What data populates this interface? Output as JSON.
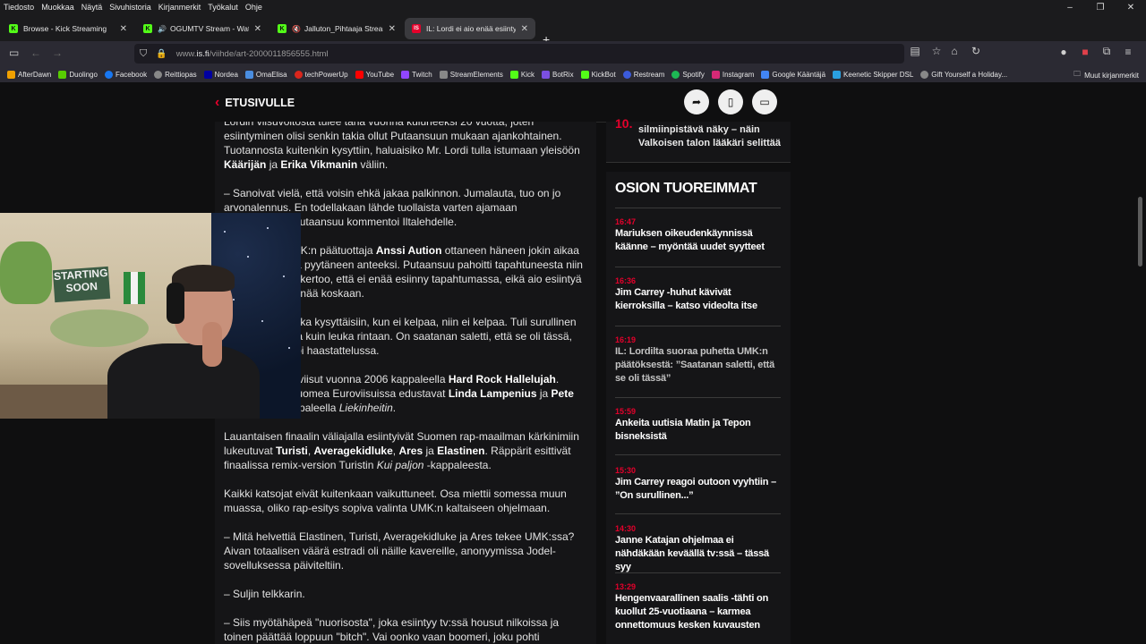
{
  "menu": [
    "Tiedosto",
    "Muokkaa",
    "Näytä",
    "Sivuhistoria",
    "Kirjanmerkit",
    "Työkalut",
    "Ohje"
  ],
  "window_controls": {
    "minimize": "–",
    "restore": "❐",
    "close": "✕"
  },
  "tabs": [
    {
      "title": "Browse - Kick Streaming",
      "favicon": "K",
      "favicon_color": "#53fc18",
      "audio": false,
      "active": false
    },
    {
      "title": "OGUMTV Stream - Watch L",
      "favicon": "K",
      "favicon_color": "#53fc18",
      "audio": true,
      "active": false
    },
    {
      "title": "Jalluton_Pihtaaja Stream - W",
      "favicon": "K",
      "favicon_color": "#53fc18",
      "audio": true,
      "active": false
    },
    {
      "title": "IL: Lordi ei aio enää esiintyä UM",
      "favicon": "IS",
      "favicon_color": "#e4002b",
      "audio": false,
      "active": true
    }
  ],
  "new_tab": "+",
  "url": {
    "prefix": "www.",
    "domain": "is.fi",
    "path": "/viihde/art-2000011856555.html"
  },
  "bookmarks": [
    {
      "label": "AfterDawn",
      "color": "#f0a000"
    },
    {
      "label": "Duolingo",
      "color": "#58cc02"
    },
    {
      "label": "Facebook",
      "color": "#1877f2"
    },
    {
      "label": "Reittiopas",
      "color": "#888888"
    },
    {
      "label": "Nordea",
      "color": "#0000a0"
    },
    {
      "label": "OmaElisa",
      "color": "#4a8de0"
    },
    {
      "label": "techPowerUp",
      "color": "#d9261c"
    },
    {
      "label": "YouTube",
      "color": "#ff0000"
    },
    {
      "label": "Twitch",
      "color": "#9146ff"
    },
    {
      "label": "StreamElements",
      "color": "#888888"
    },
    {
      "label": "Kick",
      "color": "#53fc18"
    },
    {
      "label": "BotRix",
      "color": "#7b4fe0"
    },
    {
      "label": "KickBot",
      "color": "#53fc18"
    },
    {
      "label": "Restream",
      "color": "#3b5bdb"
    },
    {
      "label": "Spotify",
      "color": "#1db954"
    },
    {
      "label": "Instagram",
      "color": "#d62976"
    },
    {
      "label": "Google Kääntäjä",
      "color": "#4285f4"
    },
    {
      "label": "Keenetic Skipper DSL",
      "color": "#2aa0e0"
    },
    {
      "label": "Gift Yourself a Holiday...",
      "color": "#888888"
    }
  ],
  "other_bookmarks": "Muut kirjanmerkit",
  "site": {
    "back_label": "ETUSIVULLE"
  },
  "article": [
    [
      {
        "t": "Lordin viisuvoitosta tulee tänä vuonna kuluneeksi 20 vuotta, joten esiintyminen olisi senkin takia ollut Putaansuun mukaan ajankohtainen. Tuotannosta kuitenkin kysyttiin, haluaisiko Mr. Lordi tulla istumaan yleisöön "
      },
      {
        "t": "Käärijän",
        "b": true
      },
      {
        "t": " ja "
      },
      {
        "t": "Erika Vikmanin",
        "b": true
      },
      {
        "t": " väliin."
      }
    ],
    [
      {
        "t": "– Sanoivat vielä, että voisin ehkä jakaa palkinnon. Jumalauta, tuo on jo arvonalennus. En todellakaan lähde tuollaista varten ajamaan Rovaniemeltä Putaansuu kommentoi Iltalehdelle."
      }
    ],
    [
      {
        "t": "Lisäksi Ylen UMK:n päätuottaja "
      },
      {
        "t": "Anssi Aution",
        "b": true
      },
      {
        "t": " ottaneen häneen jokin aikaa sitten yhteyttä ja pyytäneen anteeksi. Putaansuu pahoitti tapahtuneesta niin paljon, että hän kertoo, että ei enää esiinny tapahtumassa, eikä aio esiintyä tapahtumassa enää koskaan."
      }
    ],
    [
      {
        "t": "– En lähde, vaikka kysyttäisiin, kun ei kelpaa, niin ei kelpaa. Tuli surullinen olo ja yhtä huuta kuin leuka rintaan. On saatanan saletti, että se oli tässä, Putaansuu sanoi haastattelussa."
      }
    ],
    [
      {
        "t": "Lordi voitti Euroviisut vuonna 2006 kappaleella "
      },
      {
        "t": "Hard Rock Hallelujah",
        "b": true
      },
      {
        "t": ". Tänä vuonna Suomea Euroviisuissa edustavat "
      },
      {
        "t": "Linda Lampenius",
        "b": true
      },
      {
        "t": " ja "
      },
      {
        "t": "Pete Parkkonen",
        "b": true
      },
      {
        "t": " kappaleella "
      },
      {
        "t": "Liekinheitin",
        "i": true
      },
      {
        "t": "."
      }
    ],
    [
      {
        "t": "Lauantaisen finaalin väliajalla esiintyivät Suomen rap-maailman kärkinimiin lukeutuvat "
      },
      {
        "t": "Turisti",
        "b": true
      },
      {
        "t": ", "
      },
      {
        "t": "Averagekidluke",
        "b": true
      },
      {
        "t": ", "
      },
      {
        "t": "Ares",
        "b": true
      },
      {
        "t": " ja "
      },
      {
        "t": "Elastinen",
        "b": true
      },
      {
        "t": ". Räppärit esittivät finaalissa remix-version Turistin "
      },
      {
        "t": "Kui paljon",
        "i": true
      },
      {
        "t": " -kappaleesta."
      }
    ],
    [
      {
        "t": "Kaikki katsojat eivät kuitenkaan vaikuttuneet. Osa miettii somessa muun muassa, oliko rap-esitys sopiva valinta UMK:n kaltaiseen ohjelmaan."
      }
    ],
    [
      {
        "t": "– Mitä helvettiä Elastinen, Turisti, Averagekidluke ja Ares tekee UMK:ssa? Aivan totaalisen väärä estradi oli näille kavereille, anonyymissa Jodel-sovelluksessa päiviteltiin."
      }
    ],
    [
      {
        "t": "– Suljin telkkarin."
      }
    ],
    [
      {
        "t": "– Siis myötähäpeä \"nuorisosta\", joka esiintyy tv:ssä housut nilkoissa ja toinen päättää loppuun \"bitch\". Vai oonko vaan boomeri, joku pohti Jodelissa."
      }
    ]
  ],
  "sidebar": {
    "top_number": "10.",
    "top_headline": "silmiinpistävä näky – näin Valkoisen talon lääkäri selittää",
    "section_title": "OSION TUOREIMMAT",
    "news": [
      {
        "time": "16:47",
        "headline": "Mariuksen oikeudenkäynnissä käänne – myöntää uudet syytteet"
      },
      {
        "time": "16:36",
        "headline": "Jim Carrey -huhut kävivät kierroksilla – katso videolta itse"
      },
      {
        "time": "16:19",
        "headline": "IL: Lordilta suoraa puhetta UMK:n päätöksestä: ”Saatanan saletti, että se oli tässä”"
      },
      {
        "time": "15:59",
        "headline": "Ankeita uutisia Matin ja Tepon bisneksistä"
      },
      {
        "time": "15:30",
        "headline": "Jim Carrey reagoi outoon vyyhtiin – ”On surullinen...”"
      },
      {
        "time": "14:30",
        "headline": "Janne Katajan ohjelmaa ei nähdäkään keväällä tv:ssä – tässä syy"
      },
      {
        "time": "13:29",
        "headline": "Hengenvaarallinen saalis -tähti on kuollut 25-vuotiaana – karmea onnettomuus kesken kuvausten"
      }
    ]
  },
  "webcam": {
    "poster_text": "STARTING SOON"
  },
  "colors": {
    "accent": "#e4002b",
    "page_bg": "#0f0f10",
    "panel_bg": "#151517"
  }
}
